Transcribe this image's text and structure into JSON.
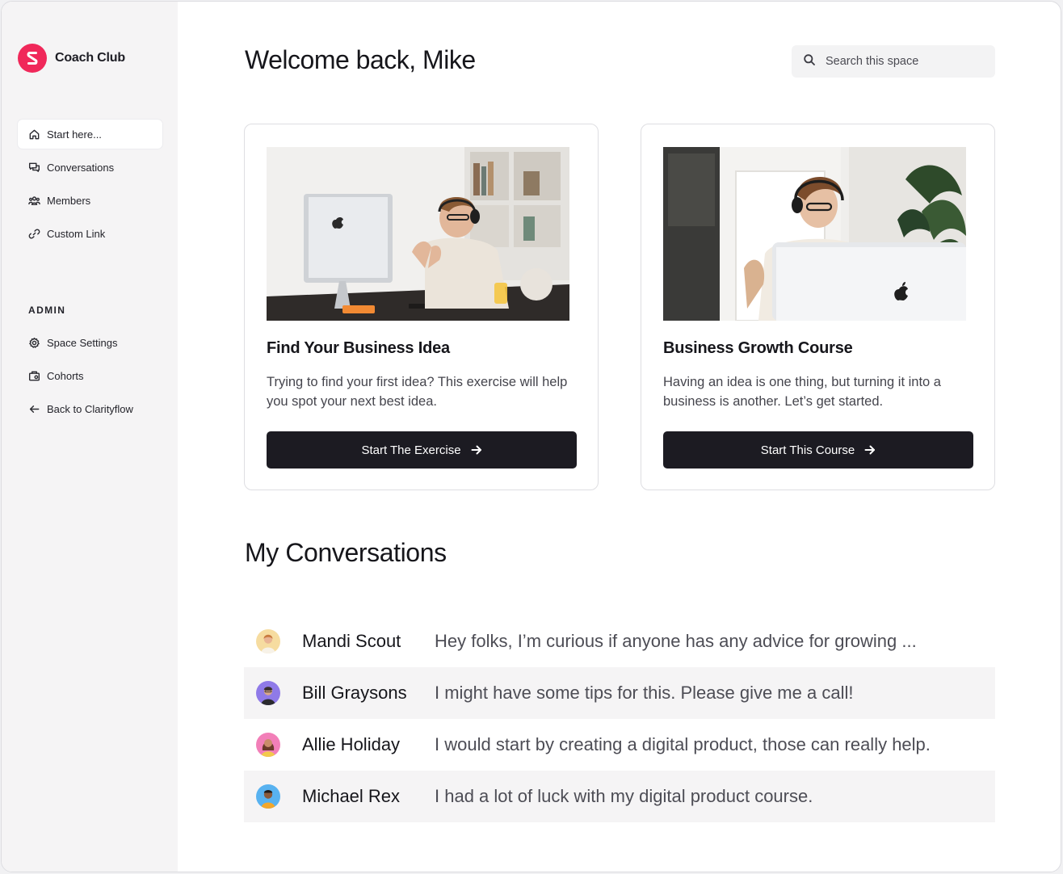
{
  "brand": {
    "name": "Coach Club",
    "accent_color": "#f0285a"
  },
  "sidebar": {
    "items": [
      {
        "label": "Start here...",
        "icon": "home-icon",
        "active": true
      },
      {
        "label": "Conversations",
        "icon": "chat-icon"
      },
      {
        "label": "Members",
        "icon": "members-icon"
      },
      {
        "label": "Custom Link",
        "icon": "link-icon"
      }
    ],
    "admin_heading": "ADMIN",
    "admin_items": [
      {
        "label": "Space Settings",
        "icon": "gear-icon"
      },
      {
        "label": "Cohorts",
        "icon": "cohorts-icon"
      },
      {
        "label": "Back to Clarityflow",
        "icon": "arrow-left-icon"
      }
    ]
  },
  "header": {
    "title": "Welcome back, Mike",
    "search_placeholder": "Search this space"
  },
  "cards": [
    {
      "title": "Find Your Business Idea",
      "description": "Trying to find your first idea? This exercise will help you spot your next best idea.",
      "button_label": "Start The Exercise"
    },
    {
      "title": "Business Growth Course",
      "description": "Having an idea is one thing, but turning it into a business is another. Let’s get started.",
      "button_label": "Start This Course"
    }
  ],
  "conversations": {
    "title": "My Conversations",
    "items": [
      {
        "name": "Mandi Scout",
        "message": "Hey folks, I’m curious if anyone has any advice for growing ..."
      },
      {
        "name": "Bill Graysons",
        "message": "I might have some tips for this. Please give me a call!"
      },
      {
        "name": "Allie Holiday",
        "message": "I would start by creating a digital product, those can really help."
      },
      {
        "name": "Michael Rex",
        "message": "I had a lot of luck with my digital product course."
      }
    ]
  }
}
